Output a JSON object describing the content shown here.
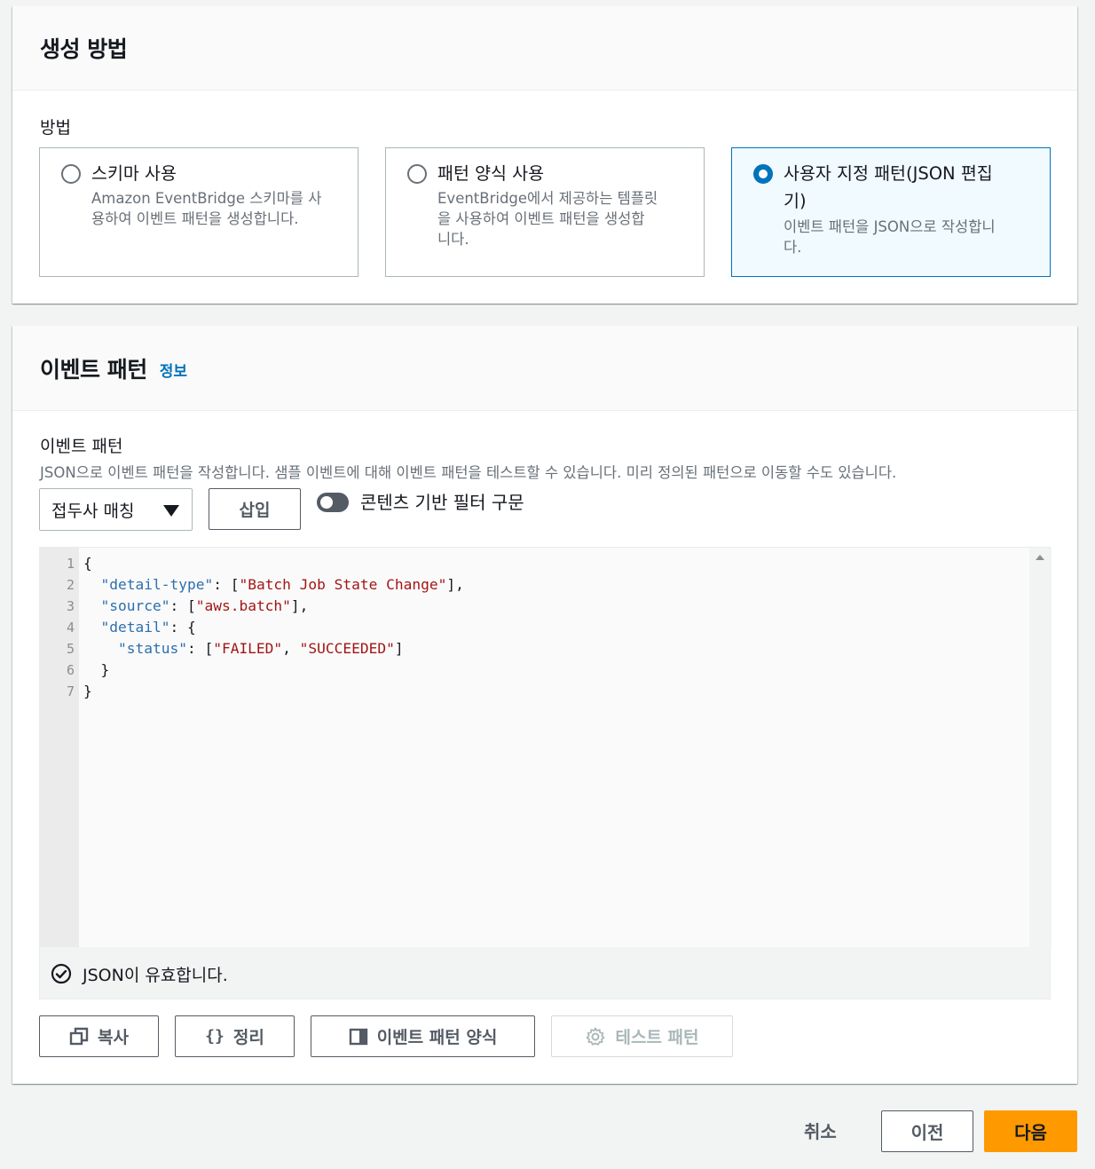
{
  "method_section": {
    "title": "생성 방법",
    "label": "방법",
    "options": [
      {
        "title": "스키마 사용",
        "desc_lines": [
          "Amazon EventBridge 스키마를 사",
          "용하여 이벤트 패턴을 생성합니다."
        ]
      },
      {
        "title": "패턴 양식 사용",
        "desc_lines": [
          "EventBridge에서 제공하는 템플릿",
          "을 사용하여 이벤트 패턴을 생성합",
          "니다."
        ]
      },
      {
        "title_lines": [
          "사용자 지정 패턴(JSON 편집",
          "기)"
        ],
        "desc_lines": [
          "이벤트 패턴을 JSON으로 작성합니",
          "다."
        ]
      }
    ],
    "selected_index": 2
  },
  "pattern_section": {
    "title": "이벤트 패턴",
    "info_link": "정보",
    "field_label": "이벤트 패턴",
    "description": "JSON으로 이벤트 패턴을 작성합니다. 샘플 이벤트에 대해 이벤트 패턴을 테스트할 수 있습니다. 미리 정의된 패턴으로 이동할 수도 있습니다.",
    "select_value": "접두사 매칭",
    "insert_button": "삽입",
    "toggle_label": "콘텐츠 기반 필터 구문",
    "toggle_on": false,
    "editor": {
      "line_numbers": [
        "1",
        "2",
        "3",
        "4",
        "5",
        "6",
        "7"
      ],
      "code_tokens": [
        {
          "t": "p",
          "v": "{"
        },
        {
          "t": "p",
          "v": "  "
        },
        {
          "t": "k",
          "v": "\"detail-type\""
        },
        {
          "t": "p",
          "v": ": ["
        },
        {
          "t": "s",
          "v": "\"Batch Job State Change\""
        },
        {
          "t": "p",
          "v": "],"
        },
        {
          "t": "p",
          "v": "  "
        },
        {
          "t": "k",
          "v": "\"source\""
        },
        {
          "t": "p",
          "v": ": ["
        },
        {
          "t": "s",
          "v": "\"aws.batch\""
        },
        {
          "t": "p",
          "v": "],"
        },
        {
          "t": "p",
          "v": "  "
        },
        {
          "t": "k",
          "v": "\"detail\""
        },
        {
          "t": "p",
          "v": ": {"
        },
        {
          "t": "p",
          "v": "    "
        },
        {
          "t": "k",
          "v": "\"status\""
        },
        {
          "t": "p",
          "v": ": ["
        },
        {
          "t": "s",
          "v": "\"FAILED\""
        },
        {
          "t": "p",
          "v": ", "
        },
        {
          "t": "s",
          "v": "\"SUCCEEDED\""
        },
        {
          "t": "p",
          "v": "]"
        },
        {
          "t": "p",
          "v": "  }"
        },
        {
          "t": "p",
          "v": "}"
        }
      ],
      "line_token_counts": [
        1,
        5,
        5,
        3,
        7,
        1,
        1
      ],
      "status_text": "JSON이 유효합니다."
    },
    "buttons": {
      "copy": "복사",
      "format": "정리",
      "pattern_form": "이벤트 패턴 양식",
      "test_pattern": "테스트 패턴"
    }
  },
  "footer": {
    "cancel": "취소",
    "previous": "이전",
    "next": "다음"
  },
  "colors": {
    "accent": "#0073bb",
    "primary_button": "#ff9900",
    "json_key": "#2c6faf",
    "json_string": "#a31515"
  }
}
